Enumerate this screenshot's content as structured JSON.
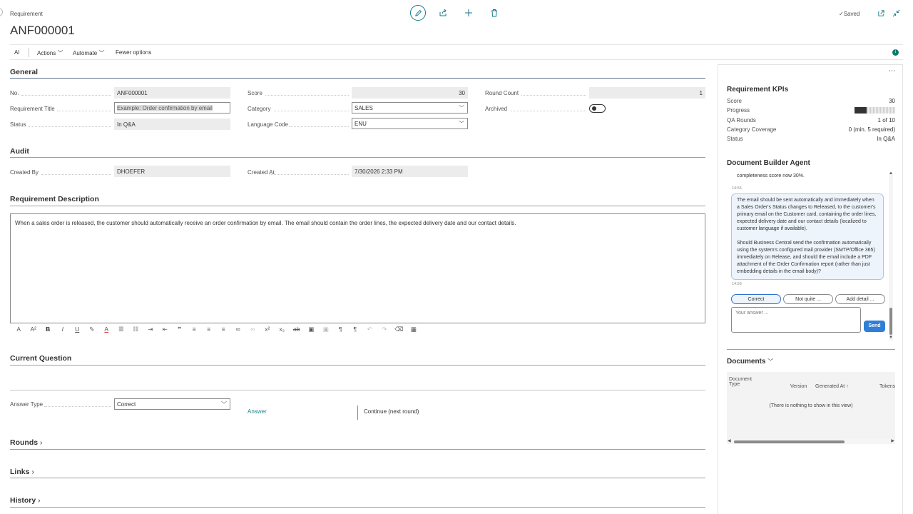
{
  "header": {
    "caption": "Requirement",
    "title": "ANF000001",
    "saved_label": "Saved",
    "icons": [
      "edit-icon",
      "share-icon",
      "add-icon",
      "delete-icon",
      "open-new-window-icon",
      "collapse-icon"
    ]
  },
  "commandbar": {
    "ai": "AI",
    "actions": "Actions",
    "automate": "Automate",
    "fewer_options": "Fewer options"
  },
  "general": {
    "heading": "General",
    "no_label": "No.",
    "no_value": "ANF000001",
    "title_label": "Requirement Title",
    "title_placeholder": "Example: Order confirmation by email",
    "status_label": "Status",
    "status_value": "In Q&A",
    "score_label": "Score",
    "score_value": "30",
    "category_label": "Category",
    "category_value": "SALES",
    "language_label": "Language Code",
    "language_value": "ENU",
    "round_count_label": "Round Count",
    "round_count_value": "1",
    "archived_label": "Archived",
    "archived_value": false
  },
  "audit": {
    "heading": "Audit",
    "created_by_label": "Created By",
    "created_by_value": "DHOEFER",
    "created_at_label": "Created At",
    "created_at_value": "7/30/2026 2:33 PM"
  },
  "description": {
    "heading": "Requirement Description",
    "text": "When a sales order is released, the customer should automatically receive an order confirmation by email. The email should contain the order lines, the expected delivery date and our contact details."
  },
  "current_question": {
    "heading": "Current Question",
    "answer_type_label": "Answer Type",
    "answer_type_value": "Correct",
    "answer_link": "Answer",
    "continue_label": "Continue (next round)"
  },
  "collapsed_sections": {
    "rounds": "Rounds",
    "links": "Links",
    "history": "History"
  },
  "kpis": {
    "heading": "Requirement KPIs",
    "score_label": "Score",
    "score_value": "30",
    "progress_label": "Progress",
    "progress_fraction": 0.3,
    "qa_rounds_label": "QA Rounds",
    "qa_rounds_value": "1 of 10",
    "coverage_label": "Category Coverage",
    "coverage_value": "0 (min. 5 required)",
    "status_label": "Status",
    "status_value": "In Q&A"
  },
  "agent": {
    "heading": "Document Builder Agent",
    "prev_text": "completeness score now 30%.",
    "prev_time": "14:56",
    "message_p1": "The email should be sent automatically and immediately when a Sales Order's Status changes to Released, to the customer's primary email on the Customer card, containing the order lines, expected delivery date and our contact details (localized to customer language if available).",
    "message_p2": "Should Business Central send the confirmation automatically using the system's configured mail provider (SMTP/Office 365) immediately on Release, and should the email include a PDF attachment of the Order Confirmation report (rather than just embedding details in the email body)?",
    "message_time": "14:56",
    "chip_correct": "Correct",
    "chip_not_quite": "Not quite ...",
    "chip_add_detail": "Add detail ...",
    "answer_placeholder": "Your answer ...",
    "send": "Send"
  },
  "documents": {
    "heading": "Documents",
    "col_doc_type_1": "Document",
    "col_doc_type_2": "Type",
    "col_version": "Version",
    "col_generated": "Generated At",
    "col_tokens": "Tokens",
    "empty": "(There is nothing to show in this view)"
  },
  "colors": {
    "accent": "#107a8a",
    "send": "#2f7fd6",
    "info_dot": "#0f7a6a"
  }
}
